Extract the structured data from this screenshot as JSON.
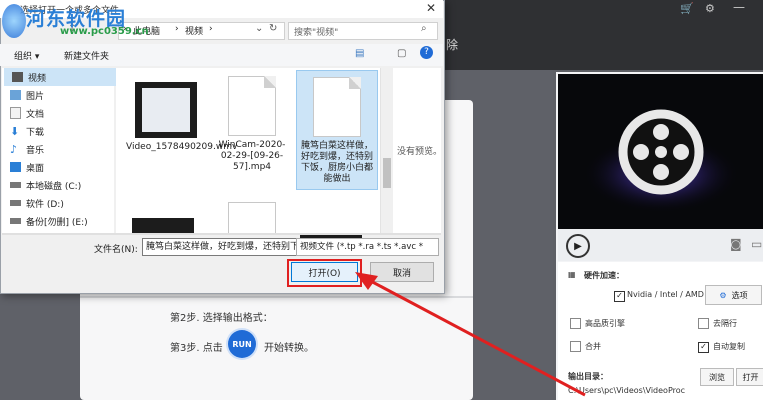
{
  "colors": {
    "accent": "#1f6bd6",
    "highlight": "#e02020",
    "app_bg": "#5f6168"
  },
  "app": {
    "step2": "第2步. 选择输出格式：",
    "step3_prefix": "第3步. 点击",
    "run_label": "RUN",
    "step3_suffix": "开始转换。",
    "right_partial": "除",
    "hw_label": "硬件加速：",
    "hw_option": "Nvidia / Intel / AMD",
    "hw_btn": "选项",
    "opt1": "高品质引擎",
    "opt2": "去隔行",
    "opt3": "合并",
    "opt4": "自动复制",
    "output_label": "输出目录：",
    "output_path": "C:\\Users\\pc\\Videos\\VideoProc",
    "browse": "浏览",
    "open": "打开"
  },
  "dialog": {
    "title": "选择打开一个或多个文件",
    "breadcrumb": [
      "此电脑",
      "视频"
    ],
    "search_placeholder": "搜索\"视频\"",
    "organize": "组织 ▾",
    "new_folder": "新建文件夹",
    "nav": [
      {
        "label": "视频",
        "icon": "video-icon"
      },
      {
        "label": "图片",
        "icon": "picture-icon"
      },
      {
        "label": "文档",
        "icon": "document-icon"
      },
      {
        "label": "下载",
        "icon": "download-icon"
      },
      {
        "label": "音乐",
        "icon": "music-icon"
      },
      {
        "label": "桌面",
        "icon": "desktop-icon"
      },
      {
        "label": "本地磁盘 (C:)",
        "icon": "drive-icon"
      },
      {
        "label": "软件 (D:)",
        "icon": "drive-icon"
      },
      {
        "label": "备份[勿删] (E:)",
        "icon": "drive-icon"
      }
    ],
    "files": [
      {
        "name": "Video_1578490209.wmv"
      },
      {
        "name": "WinCam-2020-02-29-[09-26-57].mp4"
      },
      {
        "name": "腌笃白菜这样做，好吃到爆，还特别下饭，厨房小白都能做出"
      }
    ],
    "no_preview": "没有预览。",
    "filename_label": "文件名(N):",
    "filename_value": "腌笃白菜这样做，好吃到爆，还特别下饭",
    "filetype_value": "视频文件 (*.tp *.ra *.ts *.avc *",
    "open_button": "打开(O)",
    "cancel_button": "取消"
  },
  "watermark": {
    "title": "河东软件园",
    "url": "www.pc0359.cn"
  }
}
